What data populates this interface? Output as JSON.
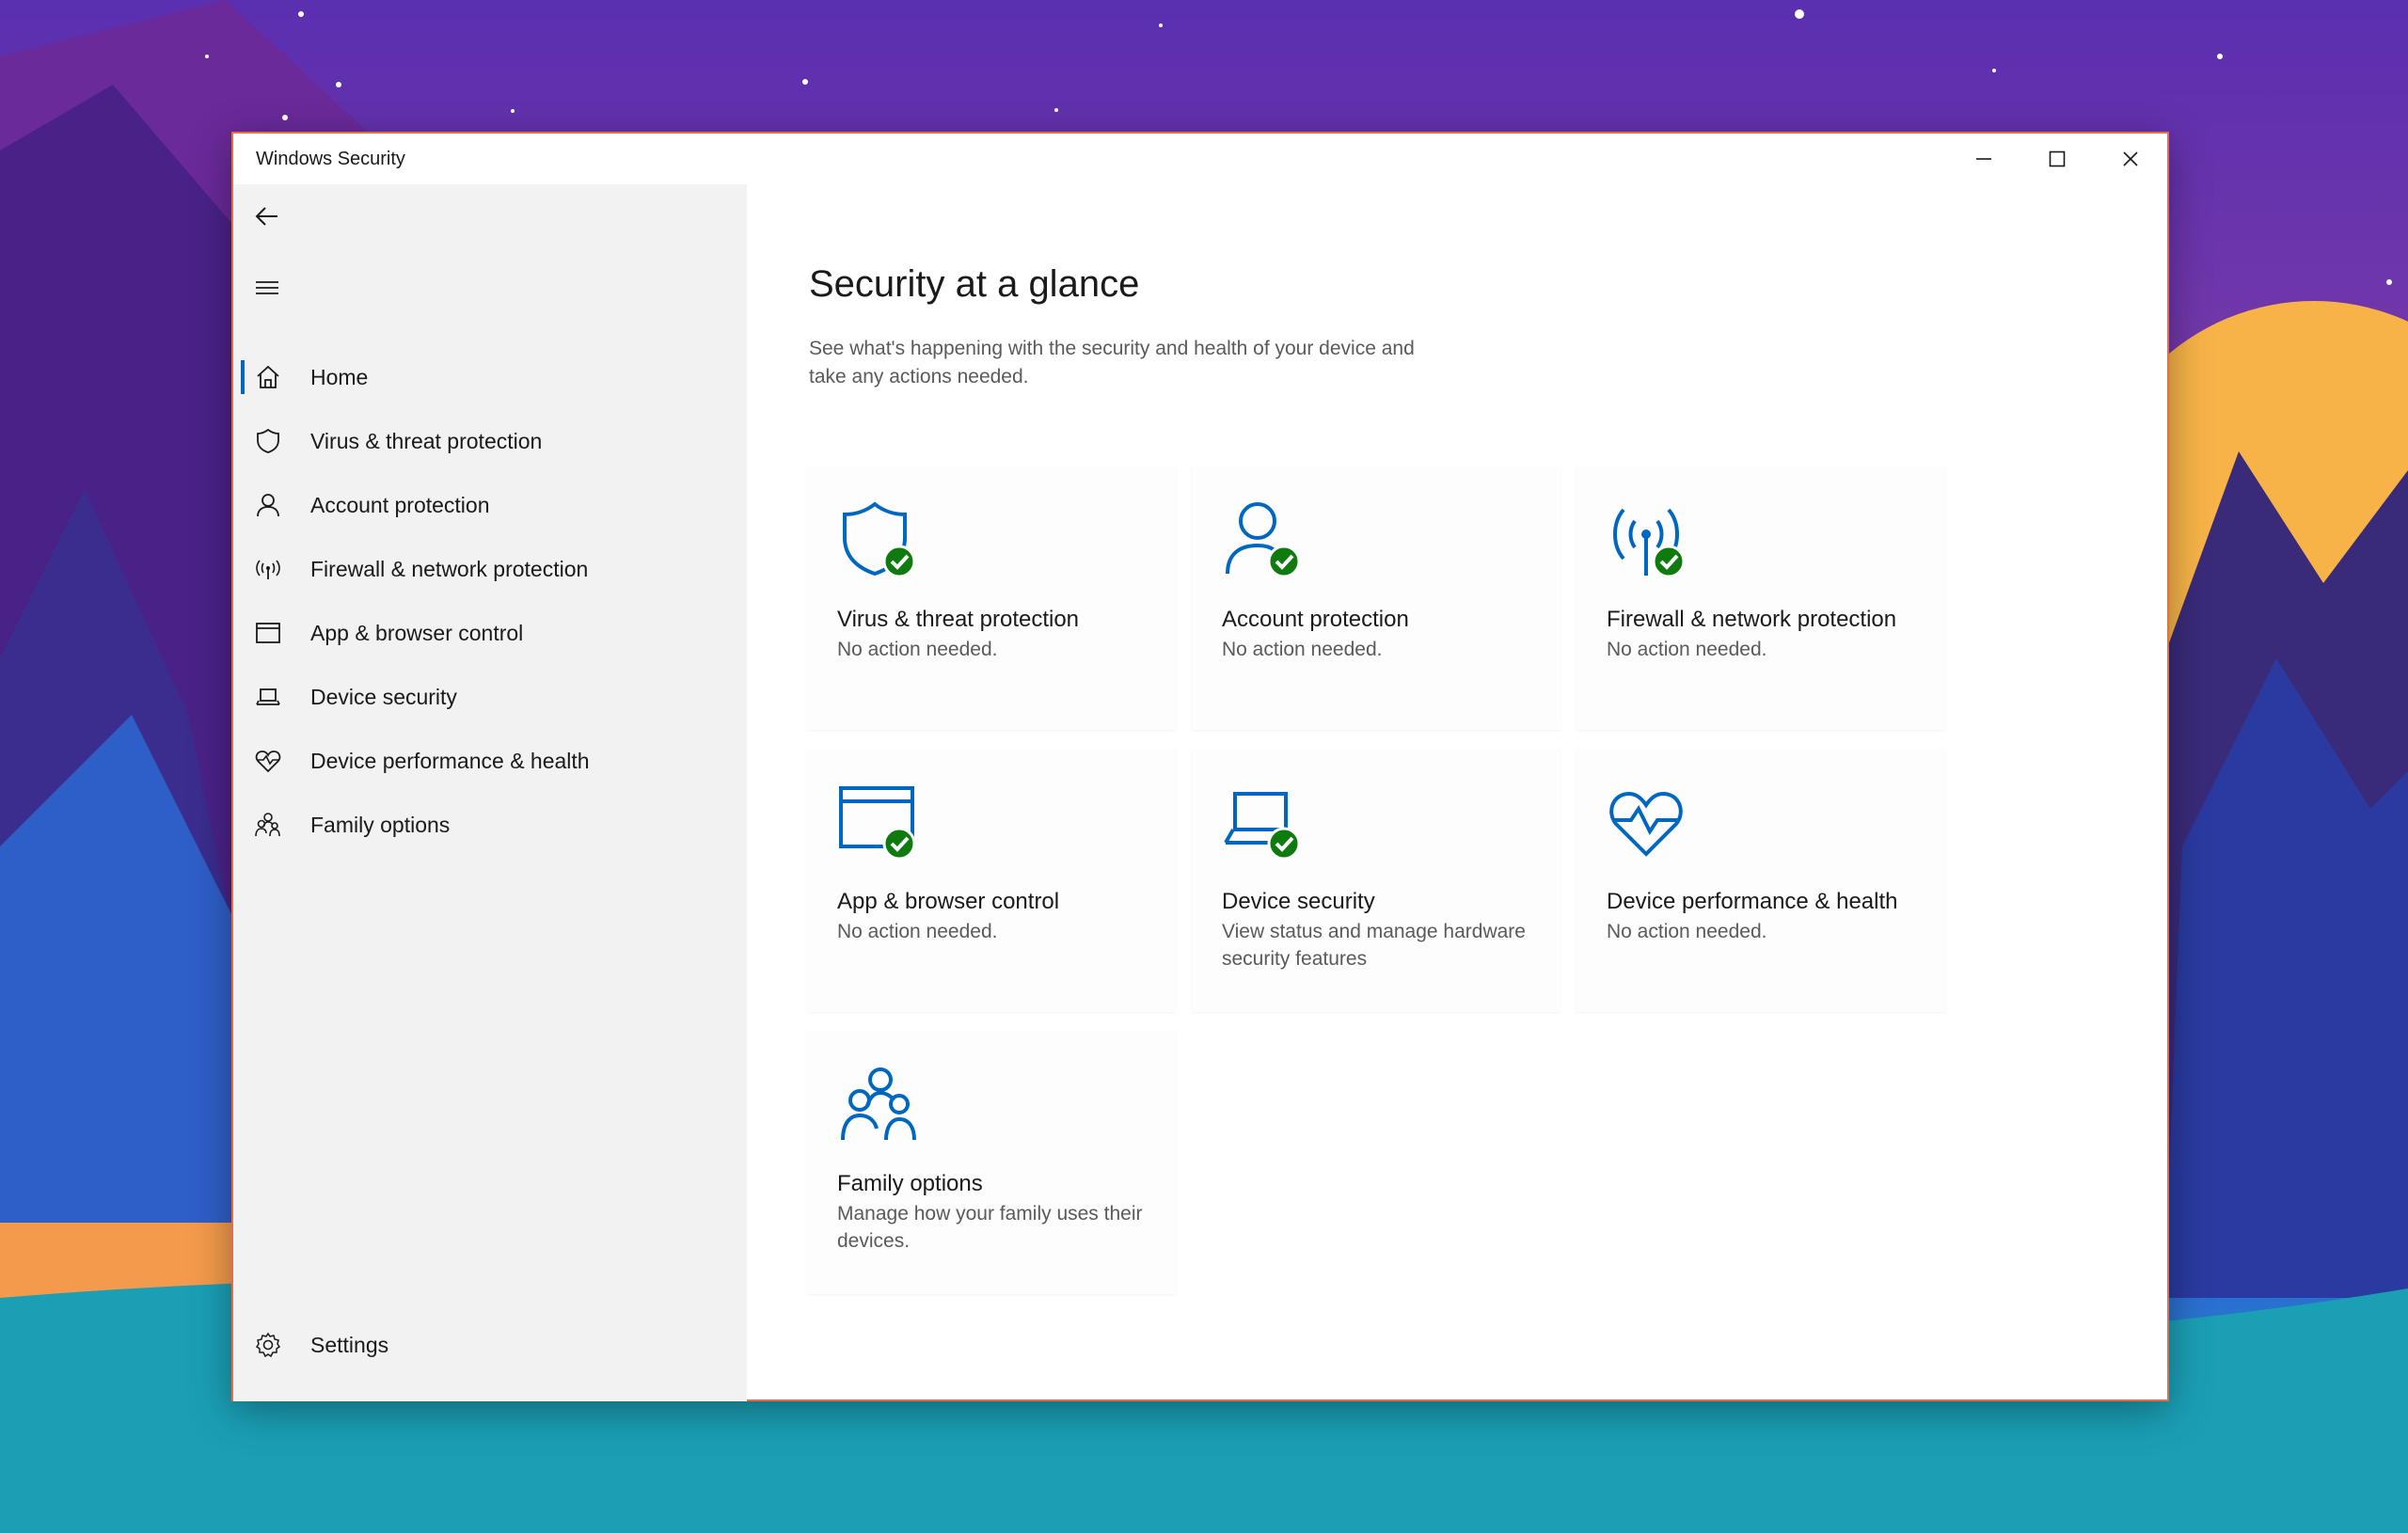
{
  "window": {
    "title": "Windows Security"
  },
  "sidebar": {
    "items": [
      {
        "label": "Home",
        "icon": "home-icon",
        "selected": true
      },
      {
        "label": "Virus & threat protection",
        "icon": "shield-icon"
      },
      {
        "label": "Account protection",
        "icon": "person-icon"
      },
      {
        "label": "Firewall & network protection",
        "icon": "antenna-icon"
      },
      {
        "label": "App & browser control",
        "icon": "browser-window-icon"
      },
      {
        "label": "Device security",
        "icon": "laptop-icon"
      },
      {
        "label": "Device performance & health",
        "icon": "heart-pulse-icon"
      },
      {
        "label": "Family options",
        "icon": "family-icon"
      }
    ],
    "settings_label": "Settings"
  },
  "main": {
    "title": "Security at a glance",
    "subtitle": "See what's happening with the security and health of your device and take any actions needed.",
    "cards": [
      {
        "title": "Virus & threat protection",
        "desc": "No action needed.",
        "icon": "shield-check-icon",
        "status": "ok"
      },
      {
        "title": "Account protection",
        "desc": "No action needed.",
        "icon": "person-check-icon",
        "status": "ok"
      },
      {
        "title": "Firewall & network protection",
        "desc": "No action needed.",
        "icon": "antenna-check-icon",
        "status": "ok"
      },
      {
        "title": "App & browser control",
        "desc": "No action needed.",
        "icon": "browser-check-icon",
        "status": "ok"
      },
      {
        "title": "Device security",
        "desc": "View status and manage hardware security features",
        "icon": "laptop-check-icon",
        "status": "ok"
      },
      {
        "title": "Device performance & health",
        "desc": "No action needed.",
        "icon": "heart-pulse-icon",
        "status": "none"
      },
      {
        "title": "Family options",
        "desc": "Manage how your family uses their devices.",
        "icon": "family-icon",
        "status": "none"
      }
    ]
  },
  "colors": {
    "accent": "#0067c0",
    "ok_badge": "#0f7b0f",
    "sidebar_bg": "#f2f2f2"
  }
}
